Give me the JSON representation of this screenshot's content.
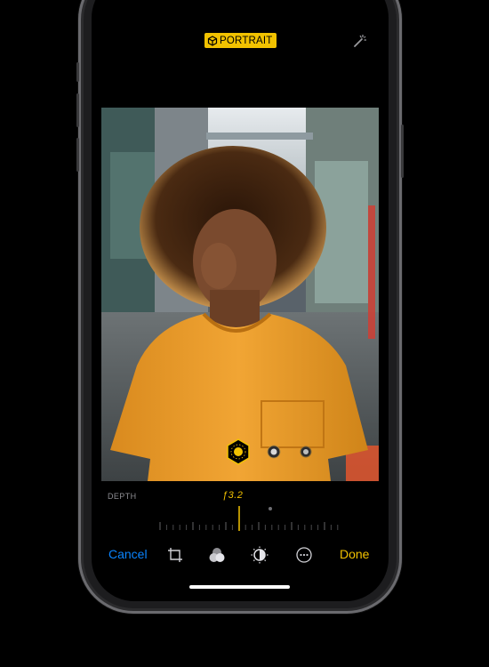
{
  "header": {
    "mode_badge": "PORTRAIT",
    "mode_icon": "cube-icon",
    "auto_enhance_icon": "magic-wand-icon"
  },
  "depth": {
    "label": "DEPTH",
    "value": "ƒ3.2",
    "slider_position": 0.4
  },
  "lighting": {
    "options": [
      "natural-light-icon",
      "studio-light-icon",
      "contour-light-icon"
    ],
    "selected_index": 0
  },
  "toolbar": {
    "cancel_label": "Cancel",
    "done_label": "Done",
    "tools": [
      "crop-rotate-icon",
      "filters-icon",
      "adjust-icon",
      "more-icon"
    ]
  },
  "colors": {
    "accent": "#f2c200",
    "cancel": "#0a84ff",
    "background": "#000000"
  }
}
